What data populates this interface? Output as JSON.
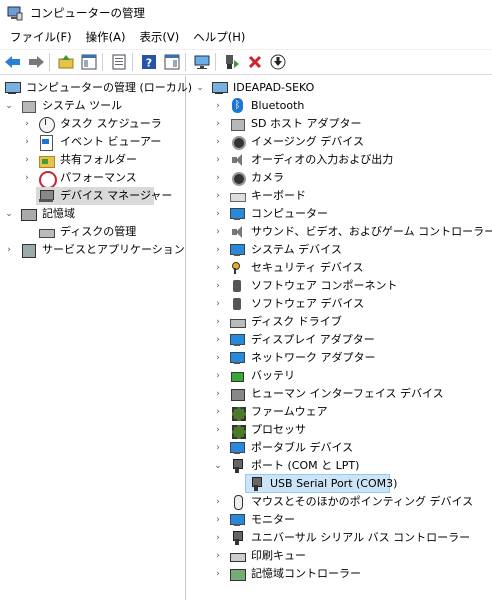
{
  "window": {
    "title": "コンピューターの管理"
  },
  "menubar": [
    "ファイル(F)",
    "操作(A)",
    "表示(V)",
    "ヘルプ(H)"
  ],
  "toolbar": {
    "icons": [
      "back-arrow-icon",
      "forward-arrow-icon",
      "up-folder-icon",
      "show-hide-tree-icon",
      "properties-icon",
      "help-icon",
      "show-action-pane-icon",
      "monitor-icon",
      "update-driver-icon",
      "uninstall-icon",
      "download-icon"
    ]
  },
  "left_tree": {
    "root": "コンピューターの管理 (ローカル)",
    "system_tools": "システム ツール",
    "task_scheduler": "タスク スケジューラ",
    "event_viewer": "イベント ビューアー",
    "shared_folders": "共有フォルダー",
    "performance": "パフォーマンス",
    "device_manager": "デバイス マネージャー",
    "storage": "記憶域",
    "disk_management": "ディスクの管理",
    "services_apps": "サービスとアプリケーション"
  },
  "device_tree": {
    "computer_name": "IDEAPAD-SEKO",
    "categories": [
      "Bluetooth",
      "SD ホスト アダプター",
      "イメージング デバイス",
      "オーディオの入力および出力",
      "カメラ",
      "キーボード",
      "コンピューター",
      "サウンド、ビデオ、およびゲーム コントローラー",
      "システム デバイス",
      "セキュリティ デバイス",
      "ソフトウェア コンポーネント",
      "ソフトウェア デバイス",
      "ディスク ドライブ",
      "ディスプレイ アダプター",
      "ネットワーク アダプター",
      "バッテリ",
      "ヒューマン インターフェイス デバイス",
      "ファームウェア",
      "プロセッサ",
      "ポータブル デバイス",
      "ポート (COM と LPT)",
      "マウスとそのほかのポインティング デバイス",
      "モニター",
      "ユニバーサル シリアル バス コントローラー",
      "印刷キュー",
      "記憶域コントローラー"
    ],
    "port_child": "USB Serial Port (COM3)"
  }
}
